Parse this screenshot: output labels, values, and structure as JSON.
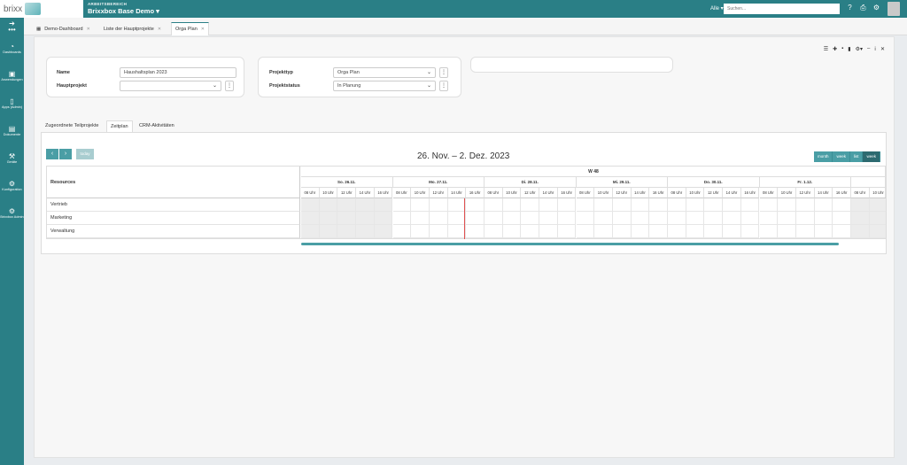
{
  "header": {
    "logo_text": "brixx",
    "workspace_label": "ARBEITSBEREICH",
    "workspace_title": "Brixxbox Base Demo",
    "search_scope": "Alle",
    "search_placeholder": "Suchen..."
  },
  "sidebar": {
    "items": [
      {
        "label": "Dashboards",
        "icon": "dashboard-icon"
      },
      {
        "label": "Anwendungen",
        "icon": "box-icon"
      },
      {
        "label": "Apps (Admin)",
        "icon": "phone-icon"
      },
      {
        "label": "Dokumente",
        "icon": "document-icon"
      },
      {
        "label": "Geräte",
        "icon": "tools-icon"
      },
      {
        "label": "Konfiguration",
        "icon": "config-icon"
      },
      {
        "label": "Brixxbox Admin",
        "icon": "admin-icon"
      }
    ]
  },
  "tabs": [
    {
      "label": "Demo-Dashboard"
    },
    {
      "label": "Liste der Hauptprojekte"
    },
    {
      "label": "Orga Plan"
    }
  ],
  "form": {
    "name_label": "Name",
    "name_value": "Haushaltsplan 2023",
    "parent_label": "Hauptprojekt",
    "parent_value": "",
    "type_label": "Projekttyp",
    "type_value": "Orga Plan",
    "status_label": "Projektstatus",
    "status_value": "In Planung"
  },
  "subtabs": [
    {
      "label": "Zugeordnete Teilprojekte"
    },
    {
      "label": "Zeitplan"
    },
    {
      "label": "CRM-Aktivitäten"
    }
  ],
  "scheduler": {
    "today_label": "today",
    "date_range": "26. Nov. – 2. Dez. 2023",
    "views": [
      "month",
      "week",
      "list",
      "week"
    ],
    "resources_header": "Resources",
    "week_label": "W 48",
    "days": [
      "So. 26.11.",
      "Mo. 27.11.",
      "Di. 28.11.",
      "Mi. 29.11.",
      "Do. 30.11.",
      "Fr. 1.12.",
      "S"
    ],
    "hours": [
      "08 Uhr",
      "10 Uhr",
      "12 Uhr",
      "14 Uhr",
      "16 Uhr"
    ],
    "resources": [
      "Vertrieb",
      "Marketing",
      "Verwaltung"
    ]
  }
}
